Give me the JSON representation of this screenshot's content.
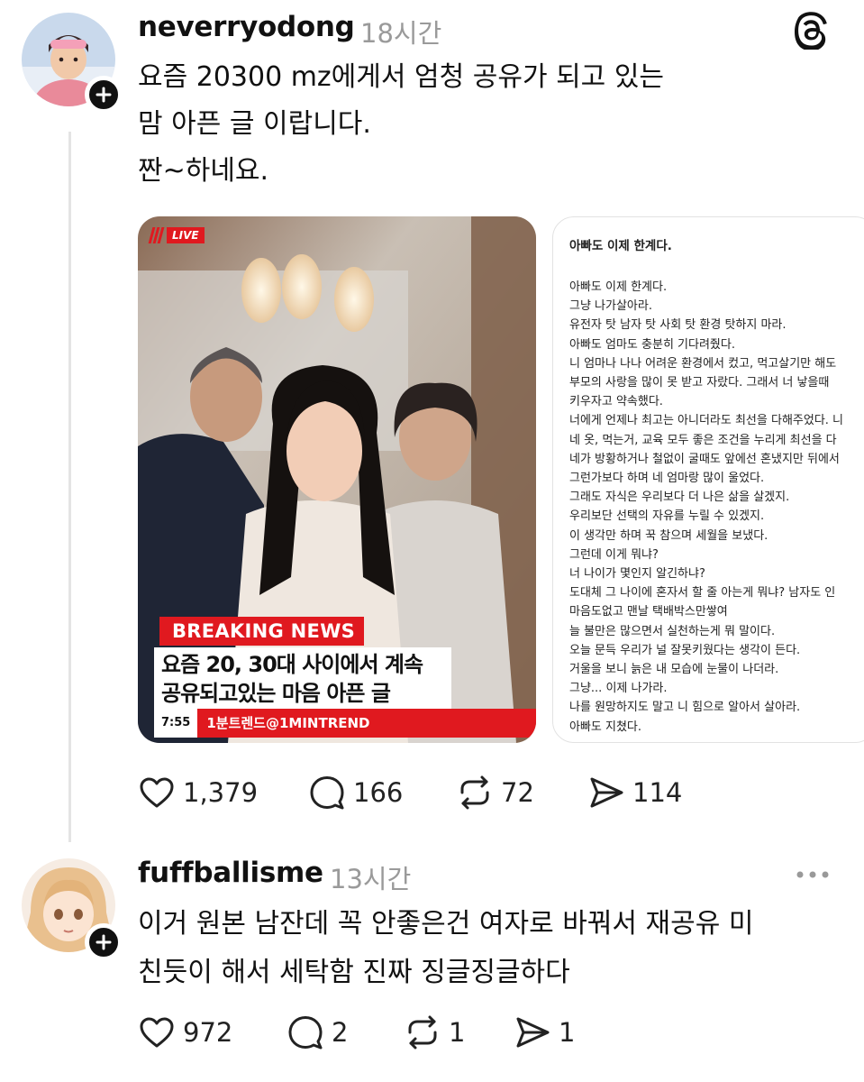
{
  "post": {
    "username": "neverryodong",
    "time": "18시간",
    "lines": [
      "요즘 20300 mz에게서 엄청 공유가 되고 있는",
      "맘 아픈 글 이랍니다.",
      "짠~하네요."
    ],
    "media": {
      "live_label": "LIVE",
      "breaking_label": "BREAKING NEWS",
      "headline_lines": [
        "요즘 20, 30대 사이에서 계속",
        "공유되고있는 마음 아픈 글"
      ],
      "ticker_time": "7:55",
      "ticker_text": "1분트렌드@1MINTREND",
      "letter_title": "아빠도 이제 한계다.",
      "letter_lines": [
        "아빠도 이제 한계다.",
        "그냥 나가살아라.",
        "유전자 탓 남자 탓 사회 탓 환경 탓하지 마라.",
        "아빠도 엄마도 충분히 기다려줬다.",
        "니 엄마나 나나 어려운 환경에서 컸고, 먹고살기만 해도",
        "부모의 사랑을 많이 못 받고 자랐다. 그래서 너 낳을때 ",
        "키우자고 약속했다.",
        "너에게 언제나 최고는 아니더라도 최선을 다해주었다. 니",
        "네 옷, 먹는거, 교육 모두 좋은 조건을 누리게 최선을 다",
        "네가 방황하거나 철없이 굴때도 앞에선 혼냈지만 뒤에서",
        "그런가보다 하며 네 엄마랑 많이 울었다.",
        "그래도 자식은 우리보다 더 나은 삶을 살겠지.",
        "우리보단 선택의 자유를 누릴 수 있겠지.",
        "이 생각만 하며 꾹 참으며 세월을 보냈다.",
        "그런데 이게 뭐냐?",
        "너 나이가 몇인지 알긴하냐?",
        "도대체 그 나이에 혼자서 할 줄 아는게 뭐냐? 남자도 인",
        "마음도없고 맨날 택배박스만쌓여",
        "늘 불만은 많으면서 실천하는게 뭐 말이다.",
        "오늘 문득 우리가 널 잘못키웠다는 생각이 든다.",
        "거울을 보니 늙은 내 모습에 눈물이 나더라.",
        "그냥... 이제 나가라.",
        "나를 원망하지도 말고 니 힘으로 알아서 살아라.",
        "아빠도 지쳤다."
      ]
    },
    "actions": {
      "likes": "1,379",
      "comments": "166",
      "reposts": "72",
      "shares": "114"
    }
  },
  "reply": {
    "username": "fuffballisme",
    "time": "13시간",
    "lines": [
      "이거 원본 남잔데 꼭 안좋은건 여자로 바꿔서 재공유 미",
      "친듯이 해서 세탁함 진짜 징글징글하다"
    ],
    "actions": {
      "likes": "972",
      "comments": "2",
      "reposts": "1",
      "shares": "1"
    }
  },
  "icons": [
    "threads-logo-icon",
    "plus-icon",
    "heart-icon",
    "comment-icon",
    "repost-icon",
    "share-icon",
    "more-icon"
  ]
}
